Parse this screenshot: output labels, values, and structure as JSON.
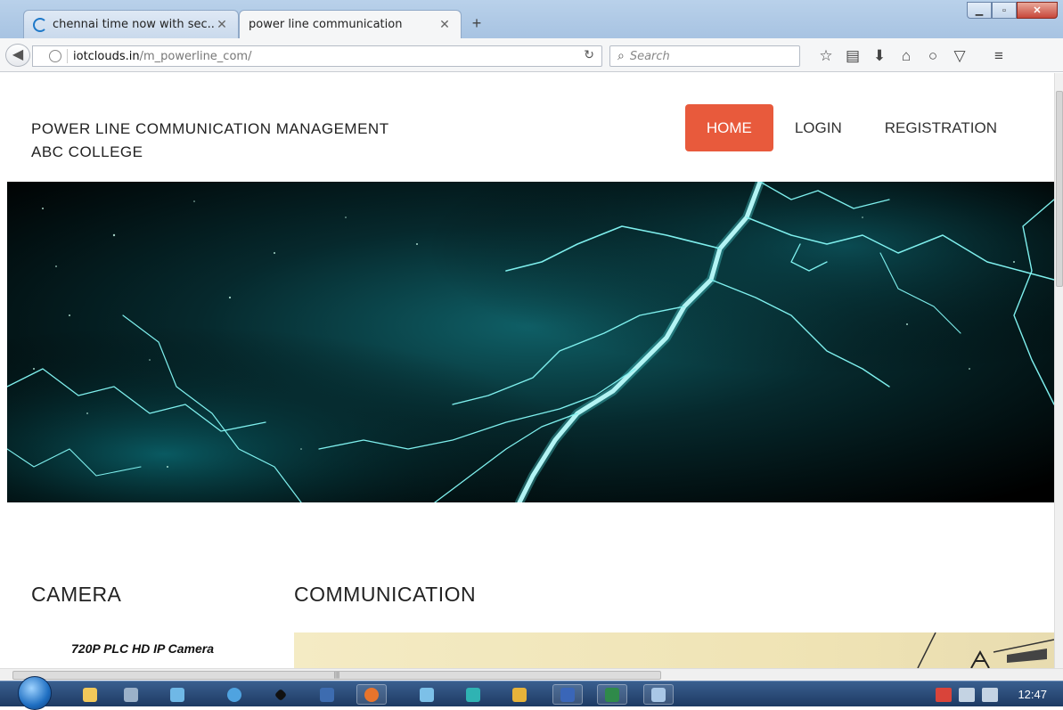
{
  "browser": {
    "tabs": [
      {
        "title": "chennai time now with sec...",
        "active": false
      },
      {
        "title": "power line communication",
        "active": true
      }
    ],
    "url_domain": "iotclouds.in",
    "url_path": "/m_powerline_com/",
    "search_placeholder": "Search"
  },
  "site": {
    "brand_line1": "POWER LINE COMMUNICATION MANAGEMENT",
    "brand_line2": "ABC COLLEGE",
    "nav": [
      {
        "label": "HOME",
        "active": true
      },
      {
        "label": "LOGIN",
        "active": false
      },
      {
        "label": "REGISTRATION",
        "active": false
      }
    ],
    "accent_color": "#e85a3c",
    "sections": {
      "camera_title": "CAMERA",
      "communication_title": "COMMUNICATION",
      "camera_caption": "720P PLC HD IP Camera"
    }
  },
  "taskbar": {
    "clock": "12:47"
  }
}
